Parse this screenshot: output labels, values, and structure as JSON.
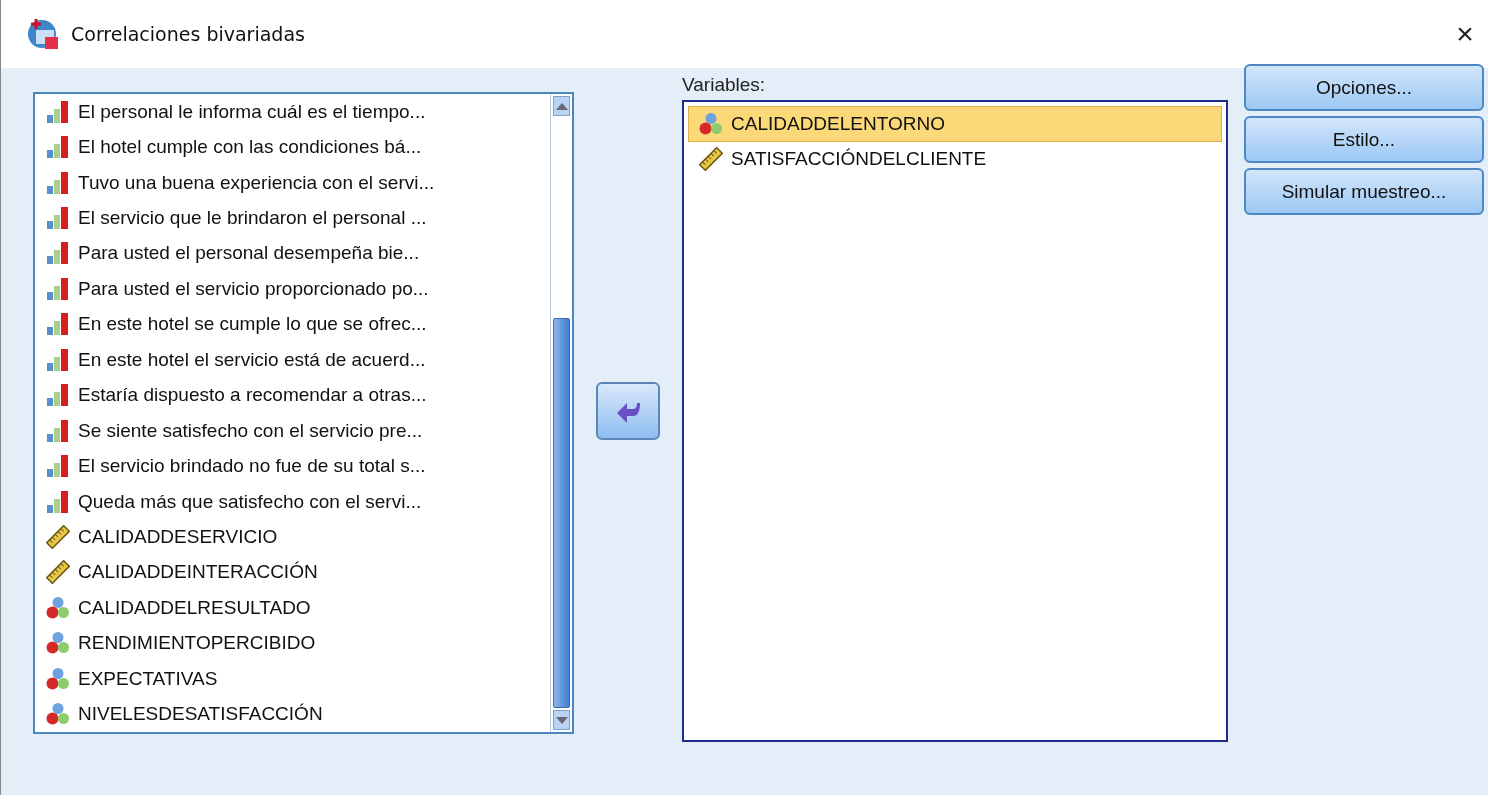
{
  "window": {
    "title": "Correlaciones bivariadas",
    "close": "×"
  },
  "source_list": {
    "items": [
      {
        "label": "El personal le informa cuál es el tiempo...",
        "kind": "ordinal"
      },
      {
        "label": "El hotel cumple con las condiciones bá...",
        "kind": "ordinal"
      },
      {
        "label": "Tuvo una buena experiencia con el servi...",
        "kind": "ordinal"
      },
      {
        "label": "El servicio que le brindaron el personal ...",
        "kind": "ordinal"
      },
      {
        "label": "Para usted el personal desempeña bie...",
        "kind": "ordinal"
      },
      {
        "label": "Para usted el servicio proporcionado po...",
        "kind": "ordinal"
      },
      {
        "label": "En este hotel se cumple lo que se ofrec...",
        "kind": "ordinal"
      },
      {
        "label": "En este hotel el servicio está de acuerd...",
        "kind": "ordinal"
      },
      {
        "label": "Estaría dispuesto a recomendar a otras...",
        "kind": "ordinal"
      },
      {
        "label": "Se siente satisfecho con el servicio pre...",
        "kind": "ordinal"
      },
      {
        "label": "El servicio brindado no fue de su total s...",
        "kind": "ordinal"
      },
      {
        "label": "Queda más que satisfecho con el servi...",
        "kind": "ordinal"
      },
      {
        "label": "CALIDADDESERVICIO",
        "kind": "scale"
      },
      {
        "label": "CALIDADDEINTERACCIÓN",
        "kind": "scale"
      },
      {
        "label": "CALIDADDELRESULTADO",
        "kind": "nominal"
      },
      {
        "label": "RENDIMIENTOPERCIBIDO",
        "kind": "nominal"
      },
      {
        "label": "EXPECTATIVAS",
        "kind": "nominal"
      },
      {
        "label": "NIVELESDESATISFACCIÓN",
        "kind": "nominal"
      }
    ]
  },
  "variables": {
    "label": "Variables:",
    "items": [
      {
        "label": "CALIDADDELENTORNO",
        "kind": "nominal",
        "selected": true
      },
      {
        "label": "SATISFACCIÓNDELCLIENTE",
        "kind": "scale",
        "selected": false
      }
    ]
  },
  "buttons": [
    "Opciones...",
    "Estilo...",
    "Simular muestreo..."
  ]
}
